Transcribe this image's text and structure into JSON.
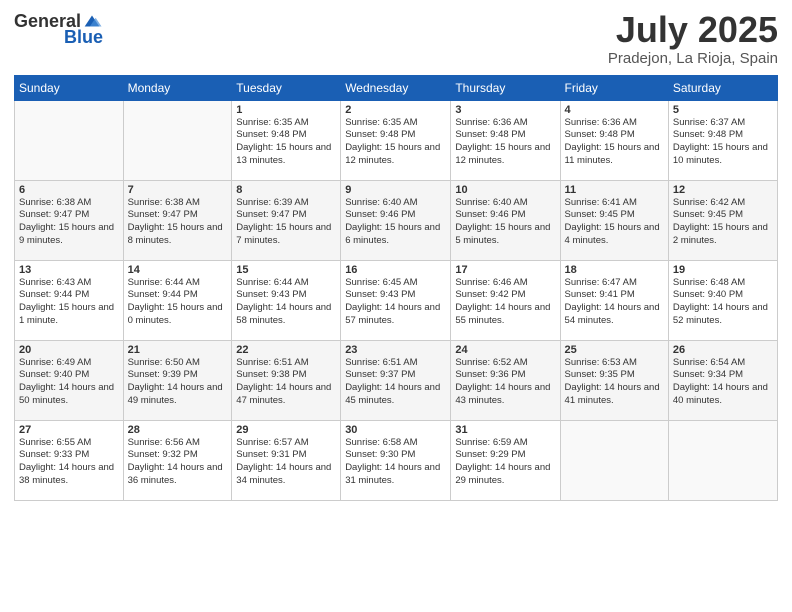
{
  "logo": {
    "general": "General",
    "blue": "Blue"
  },
  "title": "July 2025",
  "subtitle": "Pradejon, La Rioja, Spain",
  "days_header": [
    "Sunday",
    "Monday",
    "Tuesday",
    "Wednesday",
    "Thursday",
    "Friday",
    "Saturday"
  ],
  "weeks": [
    [
      {
        "day": "",
        "info": ""
      },
      {
        "day": "",
        "info": ""
      },
      {
        "day": "1",
        "info": "Sunrise: 6:35 AM\nSunset: 9:48 PM\nDaylight: 15 hours and 13 minutes."
      },
      {
        "day": "2",
        "info": "Sunrise: 6:35 AM\nSunset: 9:48 PM\nDaylight: 15 hours and 12 minutes."
      },
      {
        "day": "3",
        "info": "Sunrise: 6:36 AM\nSunset: 9:48 PM\nDaylight: 15 hours and 12 minutes."
      },
      {
        "day": "4",
        "info": "Sunrise: 6:36 AM\nSunset: 9:48 PM\nDaylight: 15 hours and 11 minutes."
      },
      {
        "day": "5",
        "info": "Sunrise: 6:37 AM\nSunset: 9:48 PM\nDaylight: 15 hours and 10 minutes."
      }
    ],
    [
      {
        "day": "6",
        "info": "Sunrise: 6:38 AM\nSunset: 9:47 PM\nDaylight: 15 hours and 9 minutes."
      },
      {
        "day": "7",
        "info": "Sunrise: 6:38 AM\nSunset: 9:47 PM\nDaylight: 15 hours and 8 minutes."
      },
      {
        "day": "8",
        "info": "Sunrise: 6:39 AM\nSunset: 9:47 PM\nDaylight: 15 hours and 7 minutes."
      },
      {
        "day": "9",
        "info": "Sunrise: 6:40 AM\nSunset: 9:46 PM\nDaylight: 15 hours and 6 minutes."
      },
      {
        "day": "10",
        "info": "Sunrise: 6:40 AM\nSunset: 9:46 PM\nDaylight: 15 hours and 5 minutes."
      },
      {
        "day": "11",
        "info": "Sunrise: 6:41 AM\nSunset: 9:45 PM\nDaylight: 15 hours and 4 minutes."
      },
      {
        "day": "12",
        "info": "Sunrise: 6:42 AM\nSunset: 9:45 PM\nDaylight: 15 hours and 2 minutes."
      }
    ],
    [
      {
        "day": "13",
        "info": "Sunrise: 6:43 AM\nSunset: 9:44 PM\nDaylight: 15 hours and 1 minute."
      },
      {
        "day": "14",
        "info": "Sunrise: 6:44 AM\nSunset: 9:44 PM\nDaylight: 15 hours and 0 minutes."
      },
      {
        "day": "15",
        "info": "Sunrise: 6:44 AM\nSunset: 9:43 PM\nDaylight: 14 hours and 58 minutes."
      },
      {
        "day": "16",
        "info": "Sunrise: 6:45 AM\nSunset: 9:43 PM\nDaylight: 14 hours and 57 minutes."
      },
      {
        "day": "17",
        "info": "Sunrise: 6:46 AM\nSunset: 9:42 PM\nDaylight: 14 hours and 55 minutes."
      },
      {
        "day": "18",
        "info": "Sunrise: 6:47 AM\nSunset: 9:41 PM\nDaylight: 14 hours and 54 minutes."
      },
      {
        "day": "19",
        "info": "Sunrise: 6:48 AM\nSunset: 9:40 PM\nDaylight: 14 hours and 52 minutes."
      }
    ],
    [
      {
        "day": "20",
        "info": "Sunrise: 6:49 AM\nSunset: 9:40 PM\nDaylight: 14 hours and 50 minutes."
      },
      {
        "day": "21",
        "info": "Sunrise: 6:50 AM\nSunset: 9:39 PM\nDaylight: 14 hours and 49 minutes."
      },
      {
        "day": "22",
        "info": "Sunrise: 6:51 AM\nSunset: 9:38 PM\nDaylight: 14 hours and 47 minutes."
      },
      {
        "day": "23",
        "info": "Sunrise: 6:51 AM\nSunset: 9:37 PM\nDaylight: 14 hours and 45 minutes."
      },
      {
        "day": "24",
        "info": "Sunrise: 6:52 AM\nSunset: 9:36 PM\nDaylight: 14 hours and 43 minutes."
      },
      {
        "day": "25",
        "info": "Sunrise: 6:53 AM\nSunset: 9:35 PM\nDaylight: 14 hours and 41 minutes."
      },
      {
        "day": "26",
        "info": "Sunrise: 6:54 AM\nSunset: 9:34 PM\nDaylight: 14 hours and 40 minutes."
      }
    ],
    [
      {
        "day": "27",
        "info": "Sunrise: 6:55 AM\nSunset: 9:33 PM\nDaylight: 14 hours and 38 minutes."
      },
      {
        "day": "28",
        "info": "Sunrise: 6:56 AM\nSunset: 9:32 PM\nDaylight: 14 hours and 36 minutes."
      },
      {
        "day": "29",
        "info": "Sunrise: 6:57 AM\nSunset: 9:31 PM\nDaylight: 14 hours and 34 minutes."
      },
      {
        "day": "30",
        "info": "Sunrise: 6:58 AM\nSunset: 9:30 PM\nDaylight: 14 hours and 31 minutes."
      },
      {
        "day": "31",
        "info": "Sunrise: 6:59 AM\nSunset: 9:29 PM\nDaylight: 14 hours and 29 minutes."
      },
      {
        "day": "",
        "info": ""
      },
      {
        "day": "",
        "info": ""
      }
    ]
  ]
}
